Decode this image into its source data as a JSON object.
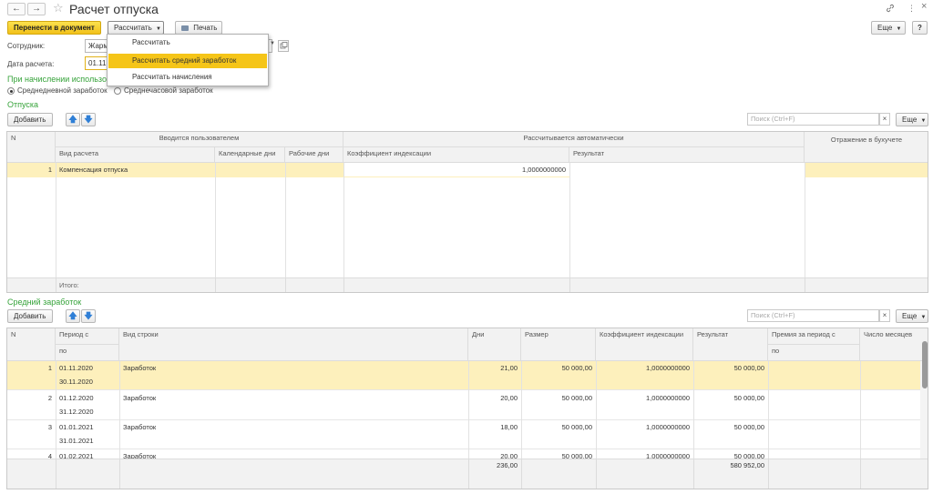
{
  "window": {
    "title": "Расчет отпуска",
    "back_glyph": "←",
    "forward_glyph": "→",
    "star_glyph": "☆",
    "link_glyph": "🔗",
    "more_glyph": "⋮",
    "close_glyph": "×"
  },
  "toolbar": {
    "transfer_label": "Перенести в документ",
    "calculate_label": "Рассчитать",
    "print_label": "Печать",
    "more_label": "Еще",
    "help_label": "?"
  },
  "dropdown": {
    "items": [
      "Рассчитать",
      "Рассчитать средний заработок",
      "Рассчитать начисления"
    ]
  },
  "form": {
    "employee_label": "Сотрудник:",
    "employee_value": "Жарм",
    "date_label": "Дата расчета:",
    "date_value": "01.11",
    "accrual_heading": "При начислении использо",
    "radio_daily": "Среднедневной заработок",
    "radio_hourly": "Среднечасовой заработок"
  },
  "vacations": {
    "heading": "Отпуска",
    "add_label": "Добавить",
    "search_placeholder": "Поиск (Ctrl+F)",
    "more_label": "Еще",
    "headers": {
      "n": "N",
      "user_group": "Вводится пользователем",
      "auto_group": "Рассчитывается автоматически",
      "accounting_group": "Отражение в бухучете",
      "kind": "Вид расчета",
      "calendar_days": "Календарные дни",
      "work_days": "Рабочие дни",
      "index_coef": "Коэффициент индексации",
      "result": "Результат"
    },
    "rows": [
      {
        "n": "1",
        "kind": "Компенсация отпуска",
        "calendar_days": "",
        "work_days": "",
        "index_coef": "1,0000000000",
        "result": ""
      }
    ],
    "footer": {
      "total_label": "Итого:"
    }
  },
  "avg_earnings": {
    "heading": "Средний заработок",
    "add_label": "Добавить",
    "search_placeholder": "Поиск (Ctrl+F)",
    "more_label": "Еще",
    "headers": {
      "n": "N",
      "period_from": "Период с",
      "period_to": "по",
      "row_kind": "Вид строки",
      "days": "Дни",
      "size": "Размер",
      "index_coef": "Коэффициент индексации",
      "result": "Результат",
      "bonus_from": "Премия за период с",
      "bonus_to": "по",
      "months": "Число месяцев"
    },
    "rows": [
      {
        "n": "1",
        "from": "01.11.2020",
        "to": "30.11.2020",
        "kind": "Заработок",
        "days": "21,00",
        "size": "50 000,00",
        "coef": "1,0000000000",
        "result": "50 000,00"
      },
      {
        "n": "2",
        "from": "01.12.2020",
        "to": "31.12.2020",
        "kind": "Заработок",
        "days": "20,00",
        "size": "50 000,00",
        "coef": "1,0000000000",
        "result": "50 000,00"
      },
      {
        "n": "3",
        "from": "01.01.2021",
        "to": "31.01.2021",
        "kind": "Заработок",
        "days": "18,00",
        "size": "50 000,00",
        "coef": "1,0000000000",
        "result": "50 000,00"
      },
      {
        "n": "4",
        "from": "01.02.2021",
        "to": "",
        "kind": "Заработок",
        "days": "20,00",
        "size": "50 000,00",
        "coef": "1,0000000000",
        "result": "50 000,00"
      }
    ],
    "footer": {
      "days_total": "236,00",
      "result_total": "580 952,00"
    }
  }
}
